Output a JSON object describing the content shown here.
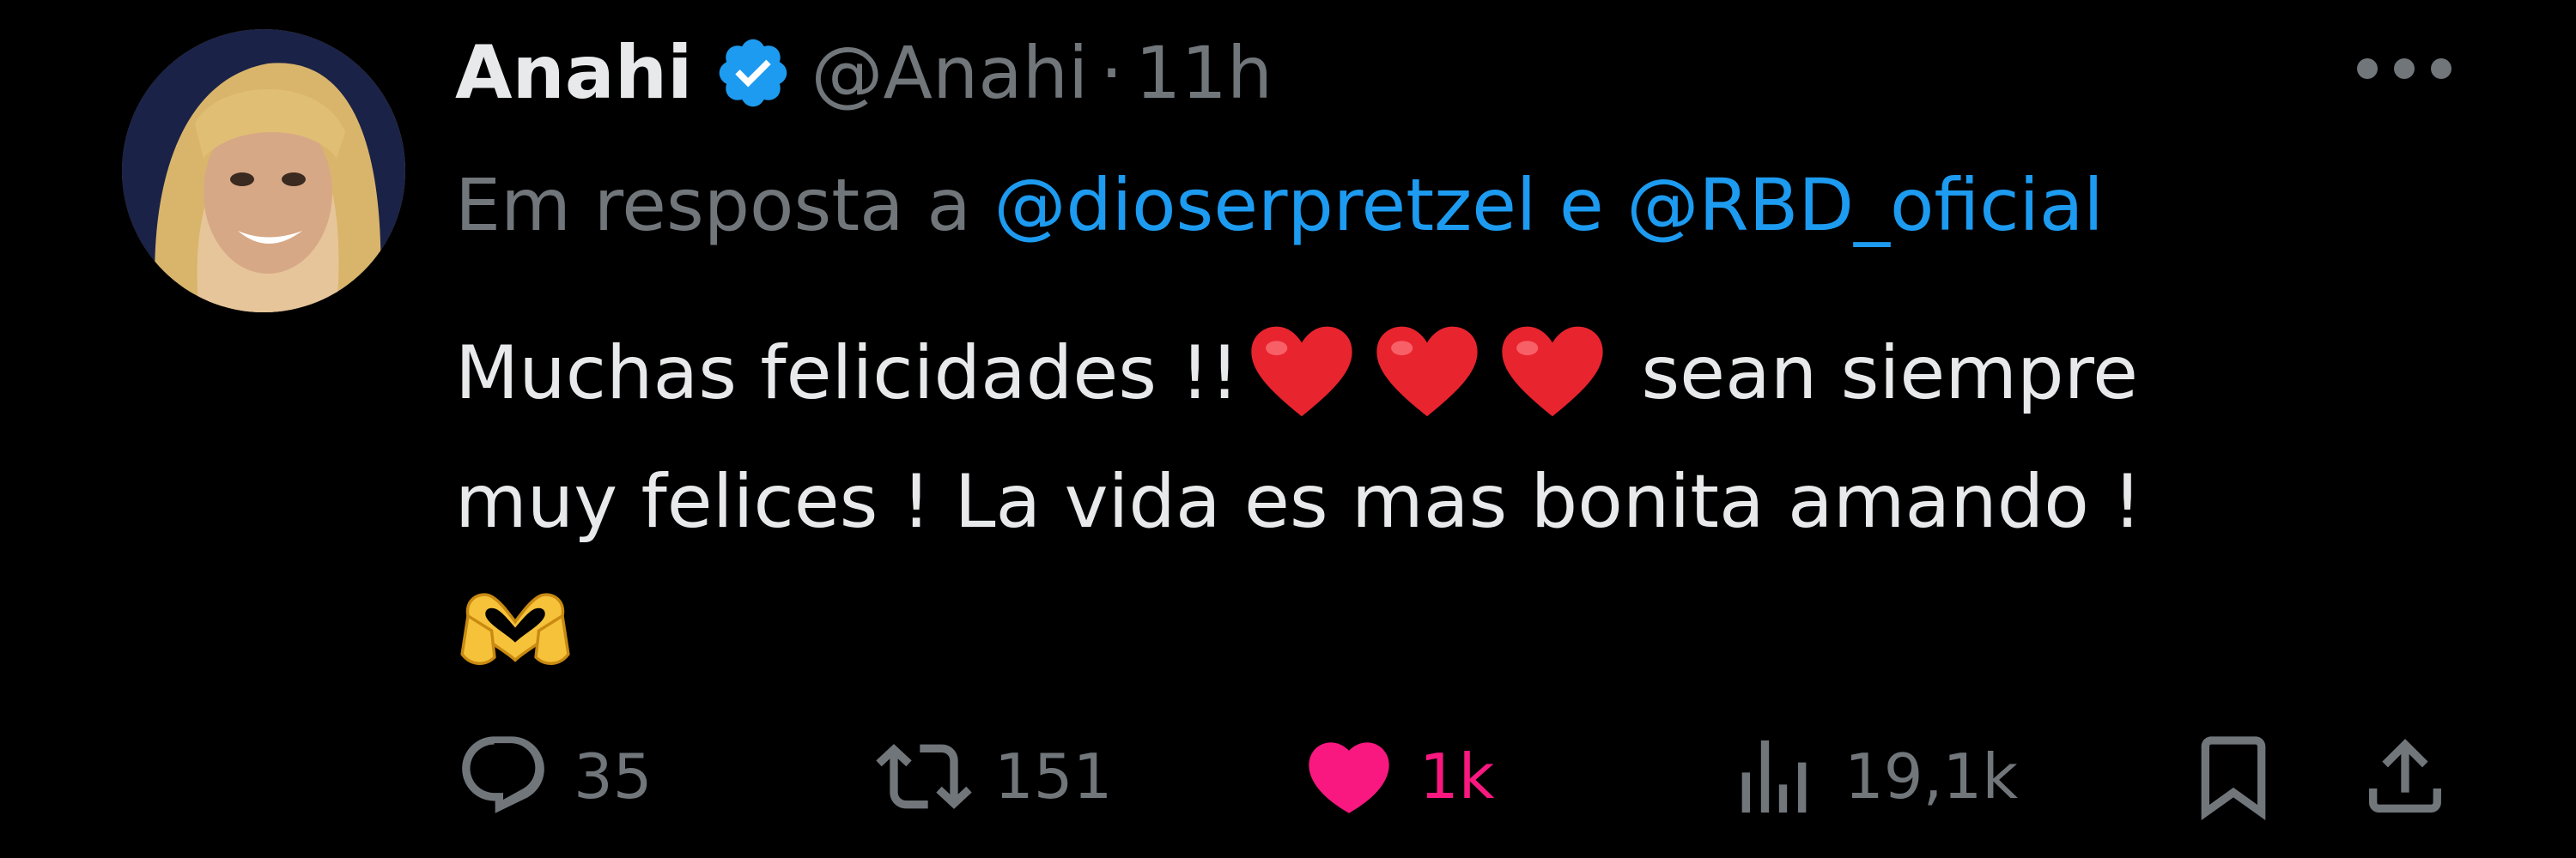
{
  "tweet": {
    "author_name": "Anahi",
    "handle": "@Anahi",
    "separator": "·",
    "time": "11h",
    "reply_prefix": "Em resposta a",
    "reply_user_1": "@dioserpretzel",
    "reply_conjunction": "e",
    "reply_user_2": "@RBD_oficial",
    "text_line1_a": "Muchas felicidades !!",
    "text_line1_b": "sean siempre",
    "text_line2": "muy felices ! La vida es mas bonita amando !",
    "emoji": [
      "red-heart",
      "red-heart",
      "red-heart",
      "heart-hands"
    ]
  },
  "actions": {
    "replies": "35",
    "retweets": "151",
    "likes": "1k",
    "views": "19,1k"
  },
  "colors": {
    "background": "#000000",
    "text": "#e7e9ea",
    "muted": "#71767b",
    "link": "#1d9bf0",
    "like": "#f91880",
    "verified": "#1d9bf0"
  }
}
